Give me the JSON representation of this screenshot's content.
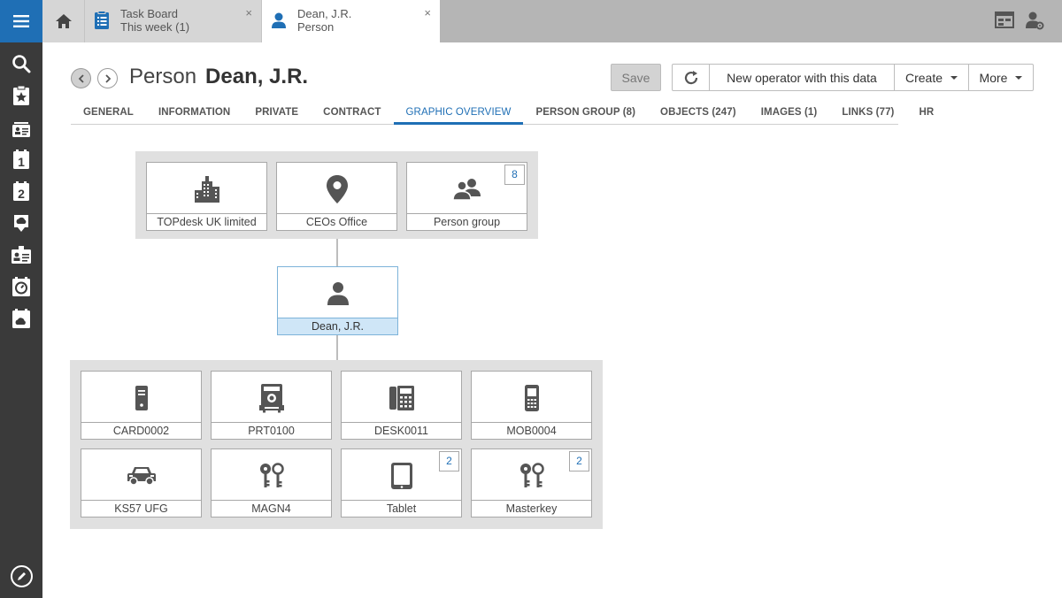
{
  "rail": {
    "accent": "#1f6fb5",
    "icons": [
      "menu-icon",
      "search-icon",
      "starred-clipboard-icon",
      "card-index-icon",
      "calendar-1-icon",
      "calendar-2-icon",
      "cloud-clipboard-icon",
      "contact-card-icon",
      "stopwatch-clipboard-icon",
      "cloud-calendar-icon",
      "edit-icon"
    ]
  },
  "tabs": [
    {
      "line1": "Task Board",
      "line2": "This week (1)",
      "icon": "task-list-icon",
      "close": "×"
    },
    {
      "line1": "Dean, J.R.",
      "line2": "Person",
      "icon": "person-icon",
      "close": "×"
    }
  ],
  "header": {
    "card_type": "Person",
    "record_name": "Dean, J.R.",
    "buttons": {
      "save": "Save",
      "new_operator": "New operator with this data",
      "create": "Create",
      "more": "More"
    }
  },
  "section_tabs": [
    {
      "label": "GENERAL",
      "active": false
    },
    {
      "label": "INFORMATION",
      "active": false
    },
    {
      "label": "PRIVATE",
      "active": false
    },
    {
      "label": "CONTRACT",
      "active": false
    },
    {
      "label": "GRAPHIC OVERVIEW",
      "active": true
    },
    {
      "label": "PERSON GROUP (8)",
      "active": false
    },
    {
      "label": "OBJECTS (247)",
      "active": false
    },
    {
      "label": "IMAGES (1)",
      "active": false
    },
    {
      "label": "LINKS (77)",
      "active": false
    },
    {
      "label": "HR",
      "active": false
    }
  ],
  "overview": {
    "top_tiles": [
      {
        "label": "TOPdesk UK limited",
        "icon": "building-icon",
        "count": null
      },
      {
        "label": "CEOs Office",
        "icon": "location-pin-icon",
        "count": null
      },
      {
        "label": "Person group",
        "icon": "people-group-icon",
        "count": "8"
      }
    ],
    "center_tile": {
      "label": "Dean, J.R.",
      "icon": "person-icon"
    },
    "object_tiles": [
      {
        "label": "CARD0002",
        "icon": "card-device-icon",
        "count": null
      },
      {
        "label": "PRT0100",
        "icon": "printer-icon",
        "count": null
      },
      {
        "label": "DESK0011",
        "icon": "desk-phone-icon",
        "count": null
      },
      {
        "label": "MOB0004",
        "icon": "mobile-phone-icon",
        "count": null
      },
      {
        "label": "KS57 UFG",
        "icon": "car-icon",
        "count": null
      },
      {
        "label": "MAGN4",
        "icon": "keys-icon",
        "count": null
      },
      {
        "label": "Tablet",
        "icon": "tablet-icon",
        "count": "2"
      },
      {
        "label": "Masterkey",
        "icon": "keys-icon",
        "count": "2"
      }
    ]
  }
}
